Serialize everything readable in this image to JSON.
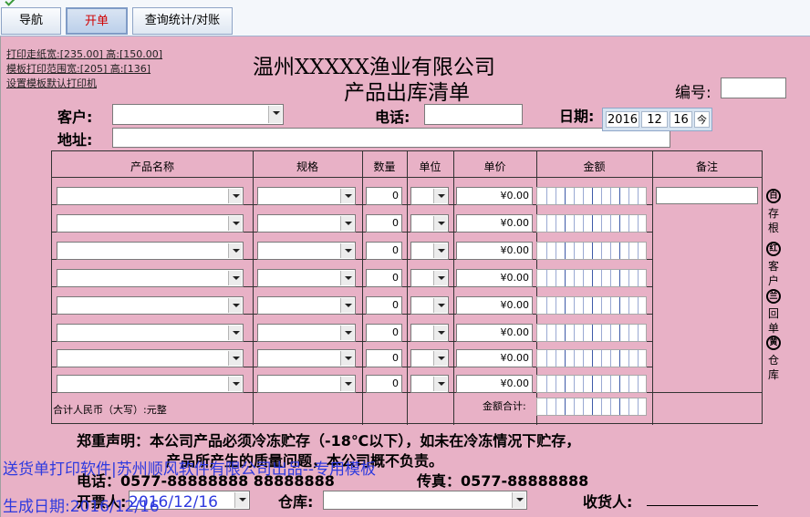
{
  "tabs": [
    {
      "label": "导航"
    },
    {
      "label": "开单"
    },
    {
      "label": "查询统计/对账"
    }
  ],
  "print_links": {
    "paper_width": "打印走纸宽:[235.00] 高:[150.00]",
    "template_range": "模板打印范围宽:[205] 高:[136]",
    "default_printer": "设置模板默认打印机"
  },
  "header": {
    "company": "温州XXXXX渔业有限公司",
    "doc_title": "产品出库清单",
    "number_label": "编号:",
    "customer_label": "客户:",
    "phone_label": "电话:",
    "date_label": "日期:",
    "address_label": "地址:"
  },
  "date": {
    "year": "2016",
    "month": "12",
    "day": "16",
    "today_btn": "今"
  },
  "table": {
    "columns": [
      "产品名称",
      "规格",
      "数量",
      "单位",
      "单价",
      "金额",
      "备注"
    ],
    "rows": [
      {
        "qty": "0",
        "price": "¥0.00"
      },
      {
        "qty": "0",
        "price": "¥0.00"
      },
      {
        "qty": "0",
        "price": "¥0.00"
      },
      {
        "qty": "0",
        "price": "¥0.00"
      },
      {
        "qty": "0",
        "price": "¥0.00"
      },
      {
        "qty": "0",
        "price": "¥0.00"
      },
      {
        "qty": "0",
        "price": "¥0.00"
      },
      {
        "qty": "0",
        "price": "¥0.00"
      }
    ],
    "total_rmb": "合计人民币（大写）:元整",
    "amount_total_label": "金额合计:"
  },
  "side_copies": [
    {
      "seal": "白",
      "label": "存根"
    },
    {
      "seal": "红",
      "label": "客户"
    },
    {
      "seal": "兰",
      "label": "回单"
    },
    {
      "seal": "黄",
      "label": "仓库"
    }
  ],
  "statement": {
    "line1": "郑重声明：本公司产品必须冷冻贮存（-18℃以下），如未在冷冻情况下贮存，",
    "line2": "产品所产生的质量问题，本公司概不负责。"
  },
  "footer": {
    "phone": "电话：0577-88888888  88888888",
    "fax": "传真：0577-88888888",
    "issuer_label": "开票人:",
    "issuer_value": "2016/12/16",
    "warehouse_label": "仓库:",
    "receiver_label": "收货人:"
  },
  "overlay": {
    "line1": "送货单打印软件|苏州顺风软件有限公司出品--专用模板",
    "line2": "生成日期:2016/12/16"
  },
  "colors": {
    "paper": "#e8b1c6",
    "active_tab_text": "#d00000",
    "overlay_text": "#2e3adf"
  }
}
